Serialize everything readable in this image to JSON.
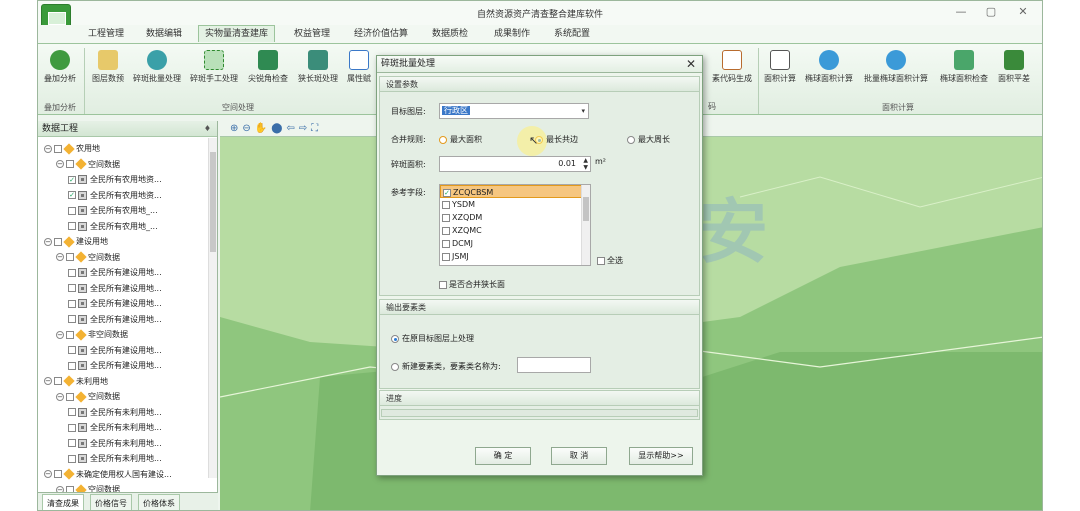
{
  "app": {
    "title": "自然资源资产清查整合建库软件"
  },
  "window_controls": {
    "minimize": "—",
    "restore": "▢",
    "close": "✕"
  },
  "menu": [
    "工程管理",
    "数据编辑",
    "实物量清查建库",
    "权益管理",
    "经济价值估算",
    "数据质检",
    "成果制作",
    "系统配置"
  ],
  "menu_active_index": 2,
  "ribbon": {
    "left_buttons": [
      "叠加分析",
      "图层数预",
      "碎斑批量处理",
      "碎斑手工处理",
      "尖锐角检查",
      "狭长斑处理",
      "属性赋"
    ],
    "right_buttons": [
      "素代码生成",
      "面积计算",
      "椭球面积计算",
      "批量椭球面积计算",
      "椭球面积检查",
      "面积平差"
    ],
    "right_fragment": "码",
    "group_labels": [
      "叠加分析",
      "空间处理",
      "面积计算"
    ]
  },
  "left_panel": {
    "title": "数据工程",
    "pin": "♦",
    "tree": [
      {
        "depth": 0,
        "kind": "folder",
        "label": "农用地"
      },
      {
        "depth": 1,
        "kind": "folder",
        "label": "空间数据"
      },
      {
        "depth": 2,
        "kind": "layer",
        "checked": true,
        "label": "全民所有农用地资..."
      },
      {
        "depth": 2,
        "kind": "layer",
        "checked": true,
        "label": "全民所有农用地资..."
      },
      {
        "depth": 2,
        "kind": "layer",
        "checked": false,
        "label": "全民所有农用地_..."
      },
      {
        "depth": 2,
        "kind": "layer",
        "checked": false,
        "label": "全民所有农用地_..."
      },
      {
        "depth": 0,
        "kind": "folder",
        "label": "建设用地"
      },
      {
        "depth": 1,
        "kind": "folder",
        "label": "空间数据"
      },
      {
        "depth": 2,
        "kind": "layer",
        "checked": false,
        "label": "全民所有建设用地..."
      },
      {
        "depth": 2,
        "kind": "layer",
        "checked": false,
        "label": "全民所有建设用地..."
      },
      {
        "depth": 2,
        "kind": "layer",
        "checked": false,
        "label": "全民所有建设用地..."
      },
      {
        "depth": 2,
        "kind": "layer",
        "checked": false,
        "label": "全民所有建设用地..."
      },
      {
        "depth": 1,
        "kind": "folder",
        "label": "非空间数据"
      },
      {
        "depth": 2,
        "kind": "layer",
        "checked": false,
        "label": "全民所有建设用地..."
      },
      {
        "depth": 2,
        "kind": "layer",
        "checked": false,
        "label": "全民所有建设用地..."
      },
      {
        "depth": 0,
        "kind": "folder",
        "label": "未利用地"
      },
      {
        "depth": 1,
        "kind": "folder",
        "label": "空间数据"
      },
      {
        "depth": 2,
        "kind": "layer",
        "checked": false,
        "label": "全民所有未利用地..."
      },
      {
        "depth": 2,
        "kind": "layer",
        "checked": false,
        "label": "全民所有未利用地..."
      },
      {
        "depth": 2,
        "kind": "layer",
        "checked": false,
        "label": "全民所有未利用地..."
      },
      {
        "depth": 2,
        "kind": "layer",
        "checked": false,
        "label": "全民所有未利用地..."
      },
      {
        "depth": 0,
        "kind": "folder",
        "label": "未确定使用权人国有建设..."
      },
      {
        "depth": 1,
        "kind": "folder",
        "label": "空间数据"
      }
    ],
    "bottom_tabs": [
      "清查成果",
      "价格信号",
      "价格体系"
    ]
  },
  "map_toolbar": "⊕⊖✋⬤⇦⇨⛶",
  "dialog": {
    "title": "碎斑批量处理",
    "close": "✕",
    "section_settings": "设置参数",
    "target_layer_label": "目标图层:",
    "target_layer_value": "行政区",
    "merge_rule_label": "合并规则:",
    "merge_options": [
      "最大面积",
      "最长共边",
      "最大周长"
    ],
    "merge_selected_index": 1,
    "fragment_area_label": "碎斑面积:",
    "fragment_area_value": "0.01",
    "fragment_area_unit": "m²",
    "ref_fields_label": "参考字段:",
    "ref_fields": [
      {
        "label": "ZCQCBSM",
        "checked": true
      },
      {
        "label": "YSDM",
        "checked": false
      },
      {
        "label": "XZQDM",
        "checked": false
      },
      {
        "label": "XZQMC",
        "checked": false
      },
      {
        "label": "DCMJ",
        "checked": false
      },
      {
        "label": "JSMJ",
        "checked": false
      }
    ],
    "select_all_label": "全选",
    "merge_narrow_label": "是否合并狭长面",
    "section_output": "输出要素类",
    "output_option_original": "在原目标图层上处理",
    "output_option_new": "新建要素类，要素类名称为:",
    "output_new_name": "",
    "section_progress": "进度",
    "progress_value": 0,
    "btn_ok": "确 定",
    "btn_cancel": "取 消",
    "btn_help": "显示帮助>>"
  },
  "watermark": "新典華安"
}
